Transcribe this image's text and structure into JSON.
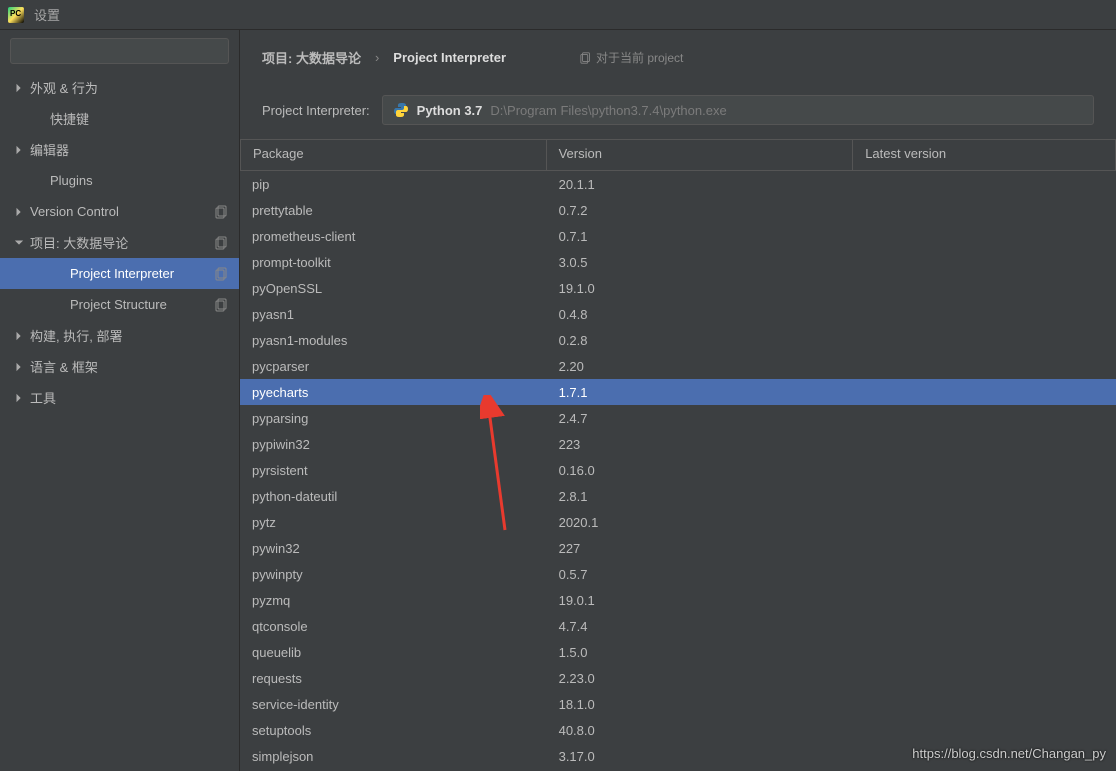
{
  "window": {
    "title": "设置"
  },
  "sidebar": {
    "searchPlaceholder": "",
    "items": [
      {
        "label": "外观 & 行为",
        "type": "parent",
        "collapsed": true
      },
      {
        "label": "快捷键",
        "type": "child"
      },
      {
        "label": "编辑器",
        "type": "parent",
        "collapsed": true
      },
      {
        "label": "Plugins",
        "type": "child"
      },
      {
        "label": "Version Control",
        "type": "parent",
        "collapsed": true,
        "copy": true
      },
      {
        "label": "项目: 大数据导论",
        "type": "parent",
        "collapsed": false,
        "copy": true
      },
      {
        "label": "Project Interpreter",
        "type": "grandchild",
        "selected": true,
        "copy": true
      },
      {
        "label": "Project Structure",
        "type": "grandchild",
        "copy": true
      },
      {
        "label": "构建, 执行, 部署",
        "type": "parent",
        "collapsed": true
      },
      {
        "label": "语言 & 框架",
        "type": "parent",
        "collapsed": true
      },
      {
        "label": "工具",
        "type": "parent",
        "collapsed": true
      }
    ]
  },
  "breadcrumb": {
    "root": "项目: 大数据导论",
    "sep": "›",
    "active": "Project Interpreter",
    "context": "对于当前 project"
  },
  "interpreter": {
    "label": "Project Interpreter:",
    "name": "Python 3.7",
    "path": "D:\\Program Files\\python3.7.4\\python.exe"
  },
  "columns": {
    "package": "Package",
    "version": "Version",
    "latest": "Latest version"
  },
  "packages": [
    {
      "name": "pip",
      "version": "20.1.1",
      "latest": ""
    },
    {
      "name": "prettytable",
      "version": "0.7.2",
      "latest": ""
    },
    {
      "name": "prometheus-client",
      "version": "0.7.1",
      "latest": ""
    },
    {
      "name": "prompt-toolkit",
      "version": "3.0.5",
      "latest": ""
    },
    {
      "name": "pyOpenSSL",
      "version": "19.1.0",
      "latest": ""
    },
    {
      "name": "pyasn1",
      "version": "0.4.8",
      "latest": ""
    },
    {
      "name": "pyasn1-modules",
      "version": "0.2.8",
      "latest": ""
    },
    {
      "name": "pycparser",
      "version": "2.20",
      "latest": ""
    },
    {
      "name": "pyecharts",
      "version": "1.7.1",
      "latest": "",
      "selected": true
    },
    {
      "name": "pyparsing",
      "version": "2.4.7",
      "latest": ""
    },
    {
      "name": "pypiwin32",
      "version": "223",
      "latest": ""
    },
    {
      "name": "pyrsistent",
      "version": "0.16.0",
      "latest": ""
    },
    {
      "name": "python-dateutil",
      "version": "2.8.1",
      "latest": ""
    },
    {
      "name": "pytz",
      "version": "2020.1",
      "latest": ""
    },
    {
      "name": "pywin32",
      "version": "227",
      "latest": ""
    },
    {
      "name": "pywinpty",
      "version": "0.5.7",
      "latest": ""
    },
    {
      "name": "pyzmq",
      "version": "19.0.1",
      "latest": ""
    },
    {
      "name": "qtconsole",
      "version": "4.7.4",
      "latest": ""
    },
    {
      "name": "queuelib",
      "version": "1.5.0",
      "latest": ""
    },
    {
      "name": "requests",
      "version": "2.23.0",
      "latest": ""
    },
    {
      "name": "service-identity",
      "version": "18.1.0",
      "latest": ""
    },
    {
      "name": "setuptools",
      "version": "40.8.0",
      "latest": ""
    },
    {
      "name": "simplejson",
      "version": "3.17.0",
      "latest": ""
    }
  ],
  "watermark": "https://blog.csdn.net/Changan_py"
}
